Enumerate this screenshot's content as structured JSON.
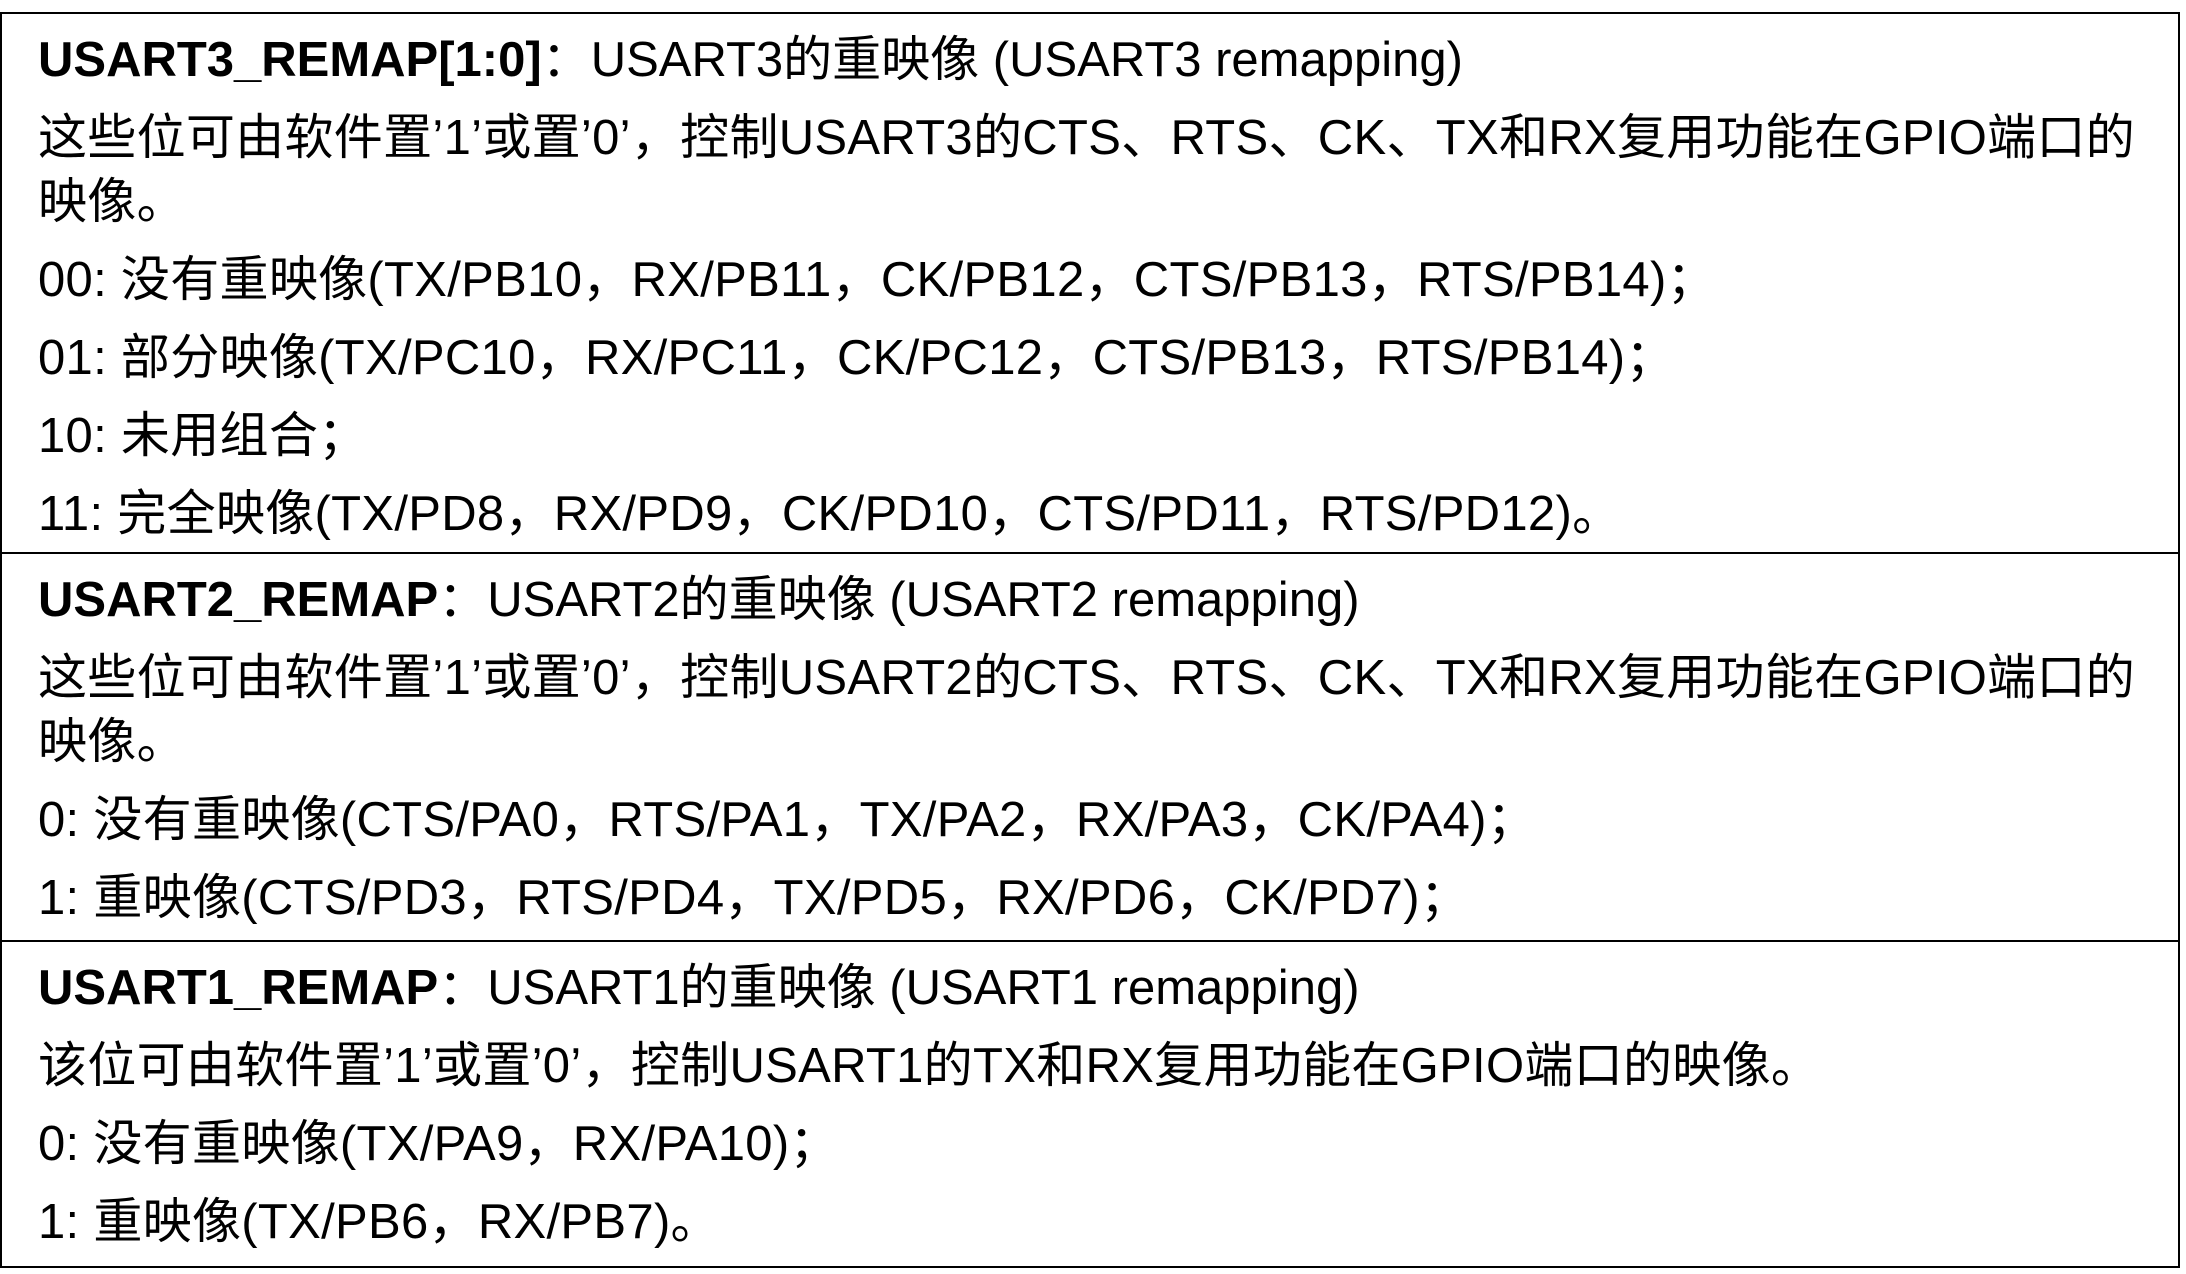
{
  "sections": [
    {
      "field": "USART3_REMAP[1:0]",
      "sep": "：",
      "title": "USART3的重映像 (USART3 remapping)",
      "description": "这些位可由软件置’1’或置’0’，控制USART3的CTS、RTS、CK、TX和RX复用功能在GPIO端口的映像。",
      "options": [
        "00: 没有重映像(TX/PB10，RX/PB11，CK/PB12，CTS/PB13，RTS/PB14)；",
        "01: 部分映像(TX/PC10，RX/PC11，CK/PC12，CTS/PB13，RTS/PB14)；",
        "10: 未用组合；",
        "11: 完全映像(TX/PD8，RX/PD9，CK/PD10，CTS/PD11，RTS/PD12)。"
      ]
    },
    {
      "field": "USART2_REMAP",
      "sep": "：",
      "title": "USART2的重映像 (USART2 remapping)",
      "description": "这些位可由软件置’1’或置’0’，控制USART2的CTS、RTS、CK、TX和RX复用功能在GPIO端口的映像。",
      "options": [
        "0: 没有重映像(CTS/PA0，RTS/PA1，TX/PA2，RX/PA3，CK/PA4)；",
        "1: 重映像(CTS/PD3，RTS/PD4，TX/PD5，RX/PD6，CK/PD7)；"
      ]
    },
    {
      "field": "USART1_REMAP",
      "sep": "：",
      "title": "USART1的重映像 (USART1 remapping)",
      "description": "该位可由软件置’1’或置’0’，控制USART1的TX和RX复用功能在GPIO端口的映像。",
      "options": [
        "0: 没有重映像(TX/PA9，RX/PA10)；",
        "1: 重映像(TX/PB6，RX/PB7)。"
      ]
    }
  ]
}
